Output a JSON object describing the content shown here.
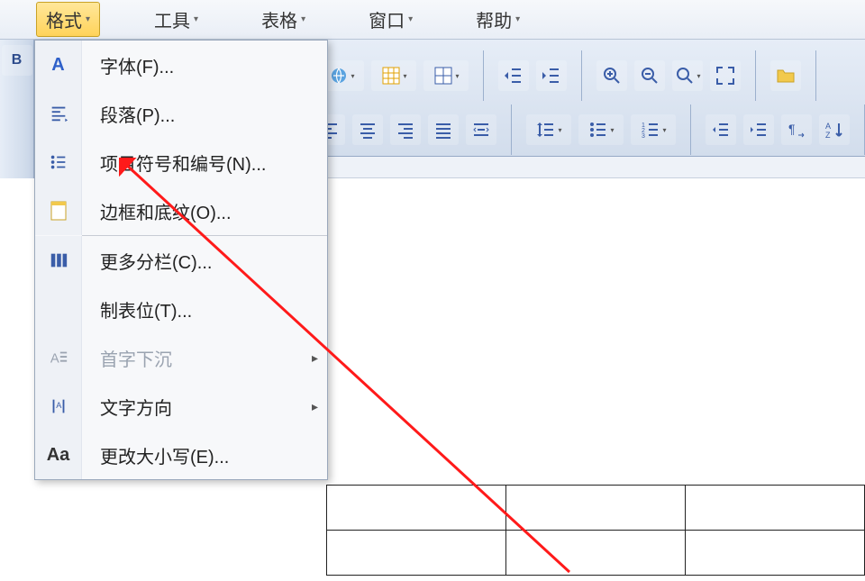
{
  "menubar": {
    "format": "格式",
    "tools": "工具",
    "table": "表格",
    "window": "窗口",
    "help": "帮助"
  },
  "dropdown": {
    "font": {
      "label": "字体(F)...",
      "key": "F"
    },
    "paragraph": {
      "label": "段落(P)...",
      "key": "P"
    },
    "bullets": {
      "label": "项目符号和编号(N)...",
      "key": "N"
    },
    "borders": {
      "label": "边框和底纹(O)...",
      "key": "O"
    },
    "columns": {
      "label": "更多分栏(C)...",
      "key": "C"
    },
    "tabs": {
      "label": "制表位(T)...",
      "key": "T"
    },
    "dropcap": {
      "label": "首字下沉",
      "key": ""
    },
    "textdir": {
      "label": "文字方向",
      "key": ""
    },
    "changecase": {
      "label": "更改大小写(E)...",
      "key": "E"
    }
  },
  "annotation": {
    "target": "dropdown.paragraph"
  }
}
